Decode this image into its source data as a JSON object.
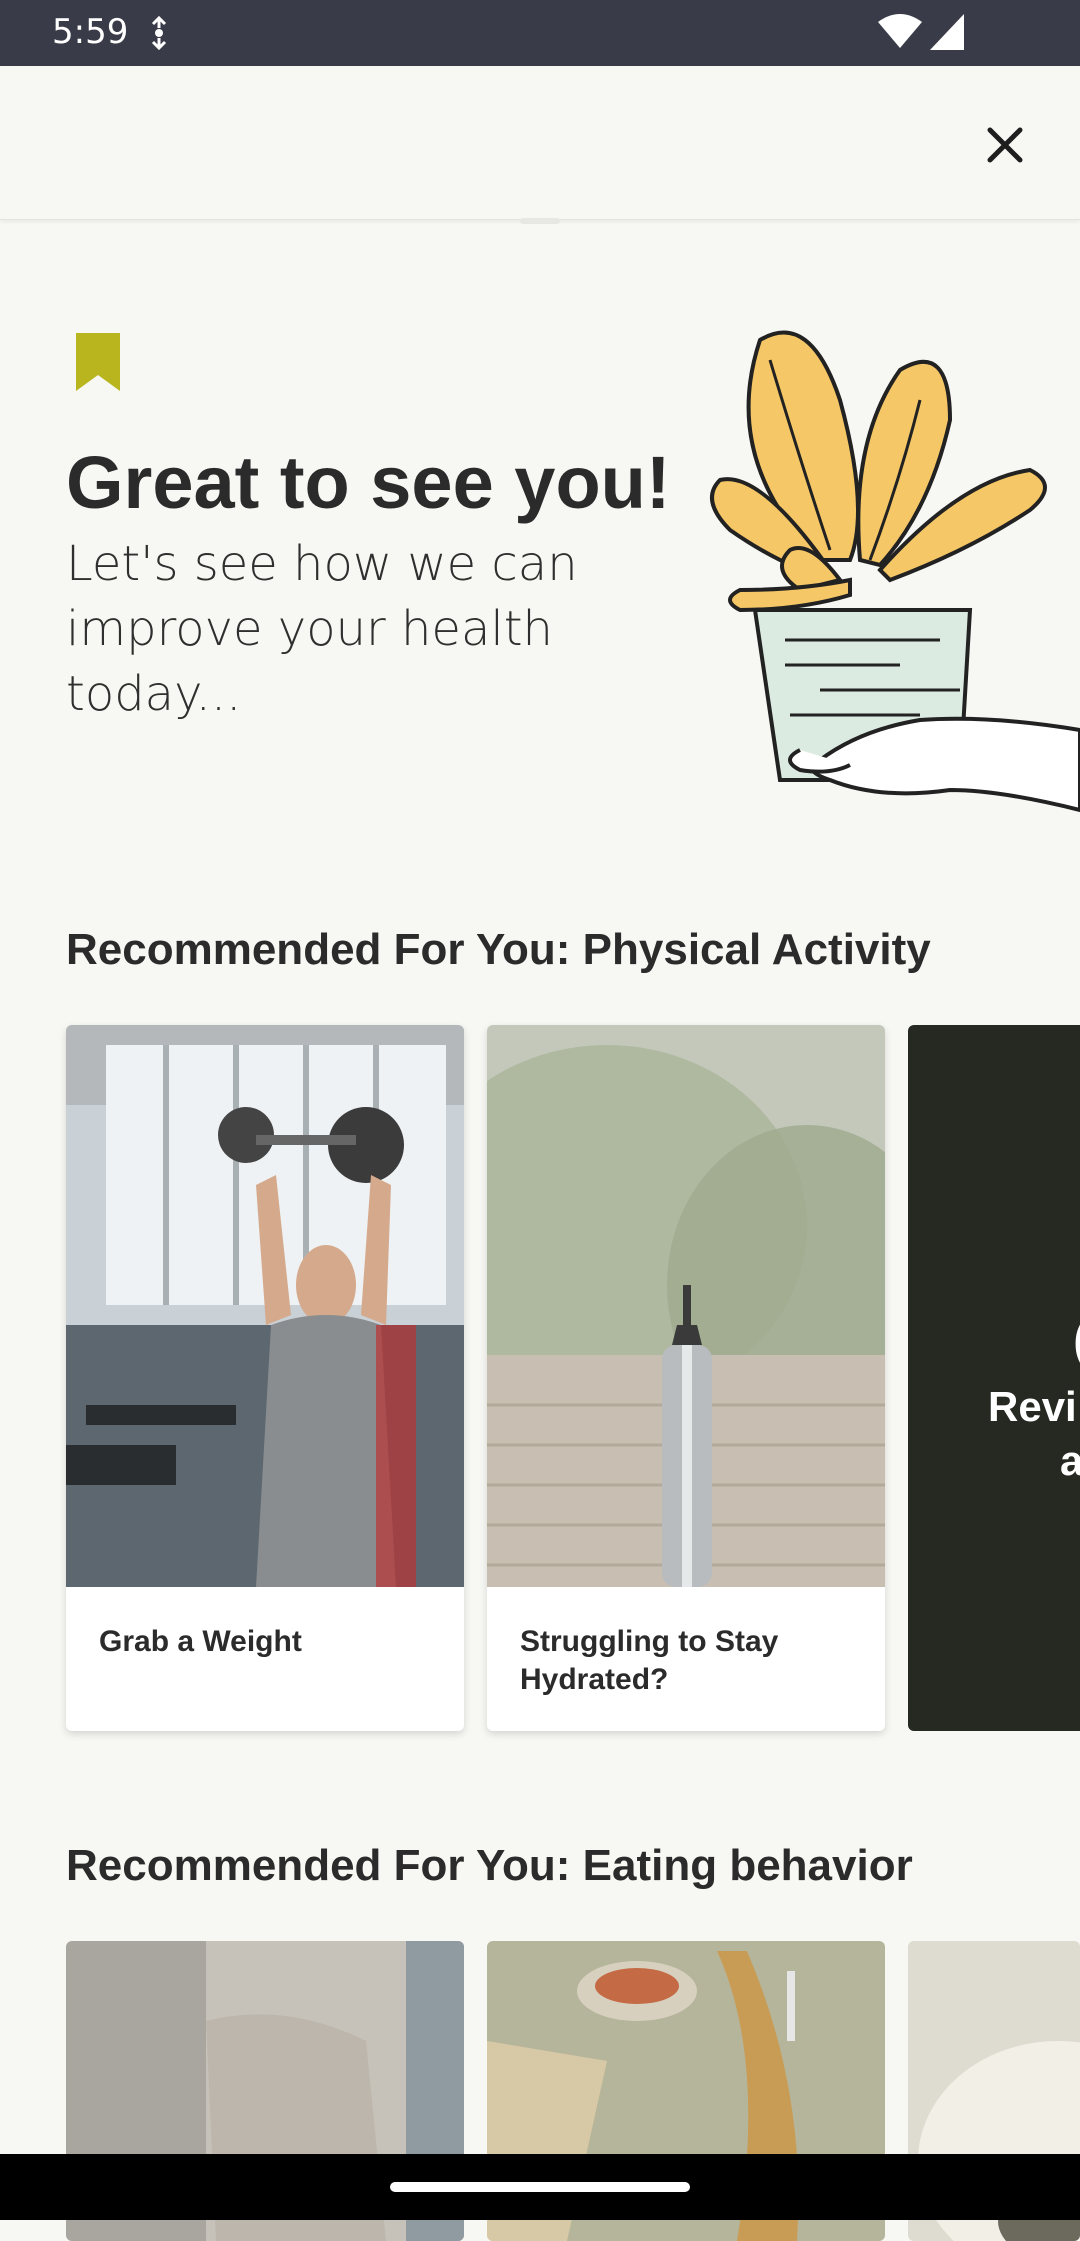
{
  "status": {
    "time": "5:59"
  },
  "hero": {
    "title": "Great to see you!",
    "subtitle": "Let's see how we can improve your health today..."
  },
  "sections": [
    {
      "title": "Recommended For You: Physical Activity",
      "cards": [
        {
          "label": "Grab a Weight"
        },
        {
          "label": "Struggling to Stay Hydrated?"
        },
        {
          "label": "Revi a"
        }
      ]
    },
    {
      "title": "Recommended For You: Eating behavior",
      "cards": []
    }
  ],
  "colors": {
    "background": "#f7f7f3",
    "accent_bookmark": "#b8b51e",
    "plant_yellow": "#f5c766",
    "dark_card": "#262922",
    "status_bar": "#3a3b48"
  },
  "icons": {
    "close": "close-icon",
    "bookmark": "bookmark-icon",
    "wifi": "wifi-icon",
    "signal": "signal-icon"
  }
}
